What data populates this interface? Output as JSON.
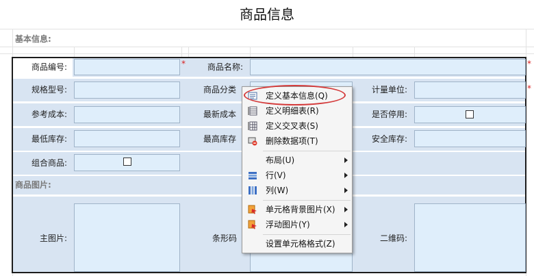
{
  "title": "商品信息",
  "sections": {
    "basic": "基本信息:",
    "images": "商品图片:"
  },
  "fields": {
    "code": "商品编号:",
    "name": "商品名称:",
    "spec": "规格型号:",
    "category": "商品分类",
    "unit": "计量单位:",
    "ref_cost": "参考成本:",
    "latest_cost": "最新成本",
    "disabled": "是否停用:",
    "min_stock": "最低库存:",
    "max_stock": "最高库存",
    "safe_stock": "安全库存:",
    "combo": "组合商品:",
    "main_image": "主图片:",
    "barcode": "条形码",
    "qrcode": "二维码:"
  },
  "required_mark": "*",
  "context_menu": {
    "items": [
      {
        "label": "定义基本信息(Q)",
        "icon": "form-icon",
        "highlighted": true
      },
      {
        "label": "定义明细表(R)",
        "icon": "detail-table-icon"
      },
      {
        "label": "定义交叉表(S)",
        "icon": "cross-table-icon"
      },
      {
        "label": "删除数据项(T)",
        "icon": "delete-item-icon"
      },
      {
        "label": "布局(U)",
        "icon": "",
        "submenu": true
      },
      {
        "label": "行(V)",
        "icon": "rows-icon",
        "submenu": true
      },
      {
        "label": "列(W)",
        "icon": "columns-icon",
        "submenu": true
      },
      {
        "label": "单元格背景图片(X)",
        "icon": "background-image-icon",
        "submenu": true
      },
      {
        "label": "浮动图片(Y)",
        "icon": "float-image-icon",
        "submenu": true
      },
      {
        "label": "设置单元格格式(Z)",
        "icon": ""
      }
    ]
  },
  "colors": {
    "input_bg": "#dfeefb",
    "band": "#d8e4f2",
    "required": "#d92020",
    "oval": "#d43a3a"
  }
}
